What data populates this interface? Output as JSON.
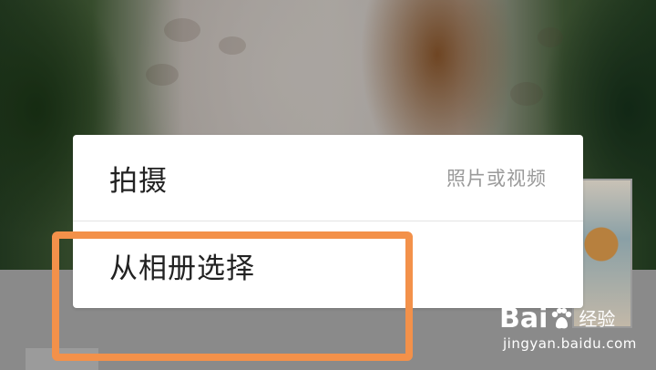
{
  "sheet": {
    "take": {
      "label": "拍摄",
      "sub": "照片或视频"
    },
    "album": {
      "label": "从相册选择"
    }
  },
  "highlight": {
    "color": "#f3914a"
  },
  "watermark": {
    "logo_left": "Bai",
    "logo_right": "经验",
    "url": "jingyan.baidu.com"
  },
  "icons": {
    "paw": "baidu-paw-icon"
  }
}
